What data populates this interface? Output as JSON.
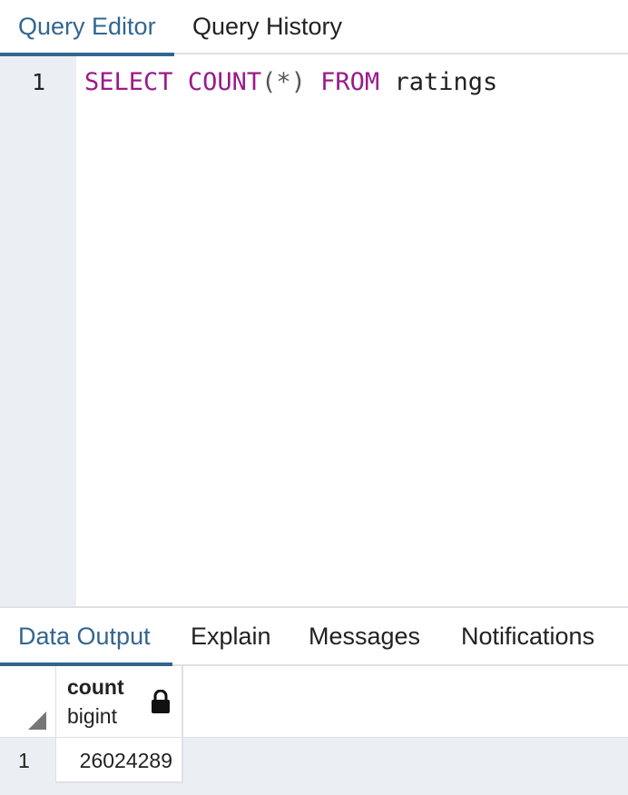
{
  "top_tabs": [
    {
      "label": "Query Editor",
      "active": true
    },
    {
      "label": "Query History",
      "active": false
    }
  ],
  "editor": {
    "line_number": "1",
    "code": {
      "kw_select": "SELECT",
      "kw_count": "COUNT",
      "paren_expr": "(*)",
      "kw_from": "FROM",
      "table": "ratings"
    }
  },
  "bottom_tabs": [
    {
      "label": "Data Output",
      "active": true
    },
    {
      "label": "Explain",
      "active": false
    },
    {
      "label": "Messages",
      "active": false
    },
    {
      "label": "Notifications",
      "active": false
    }
  ],
  "grid": {
    "columns": [
      {
        "name": "count",
        "type": "bigint",
        "icon": "lock-icon"
      }
    ],
    "rows": [
      {
        "row_number": "1",
        "values": [
          "26024289"
        ]
      }
    ]
  },
  "colors": {
    "accent": "#326690",
    "keyword": "#9a1a8c",
    "gutter_bg": "#ebeef3"
  }
}
